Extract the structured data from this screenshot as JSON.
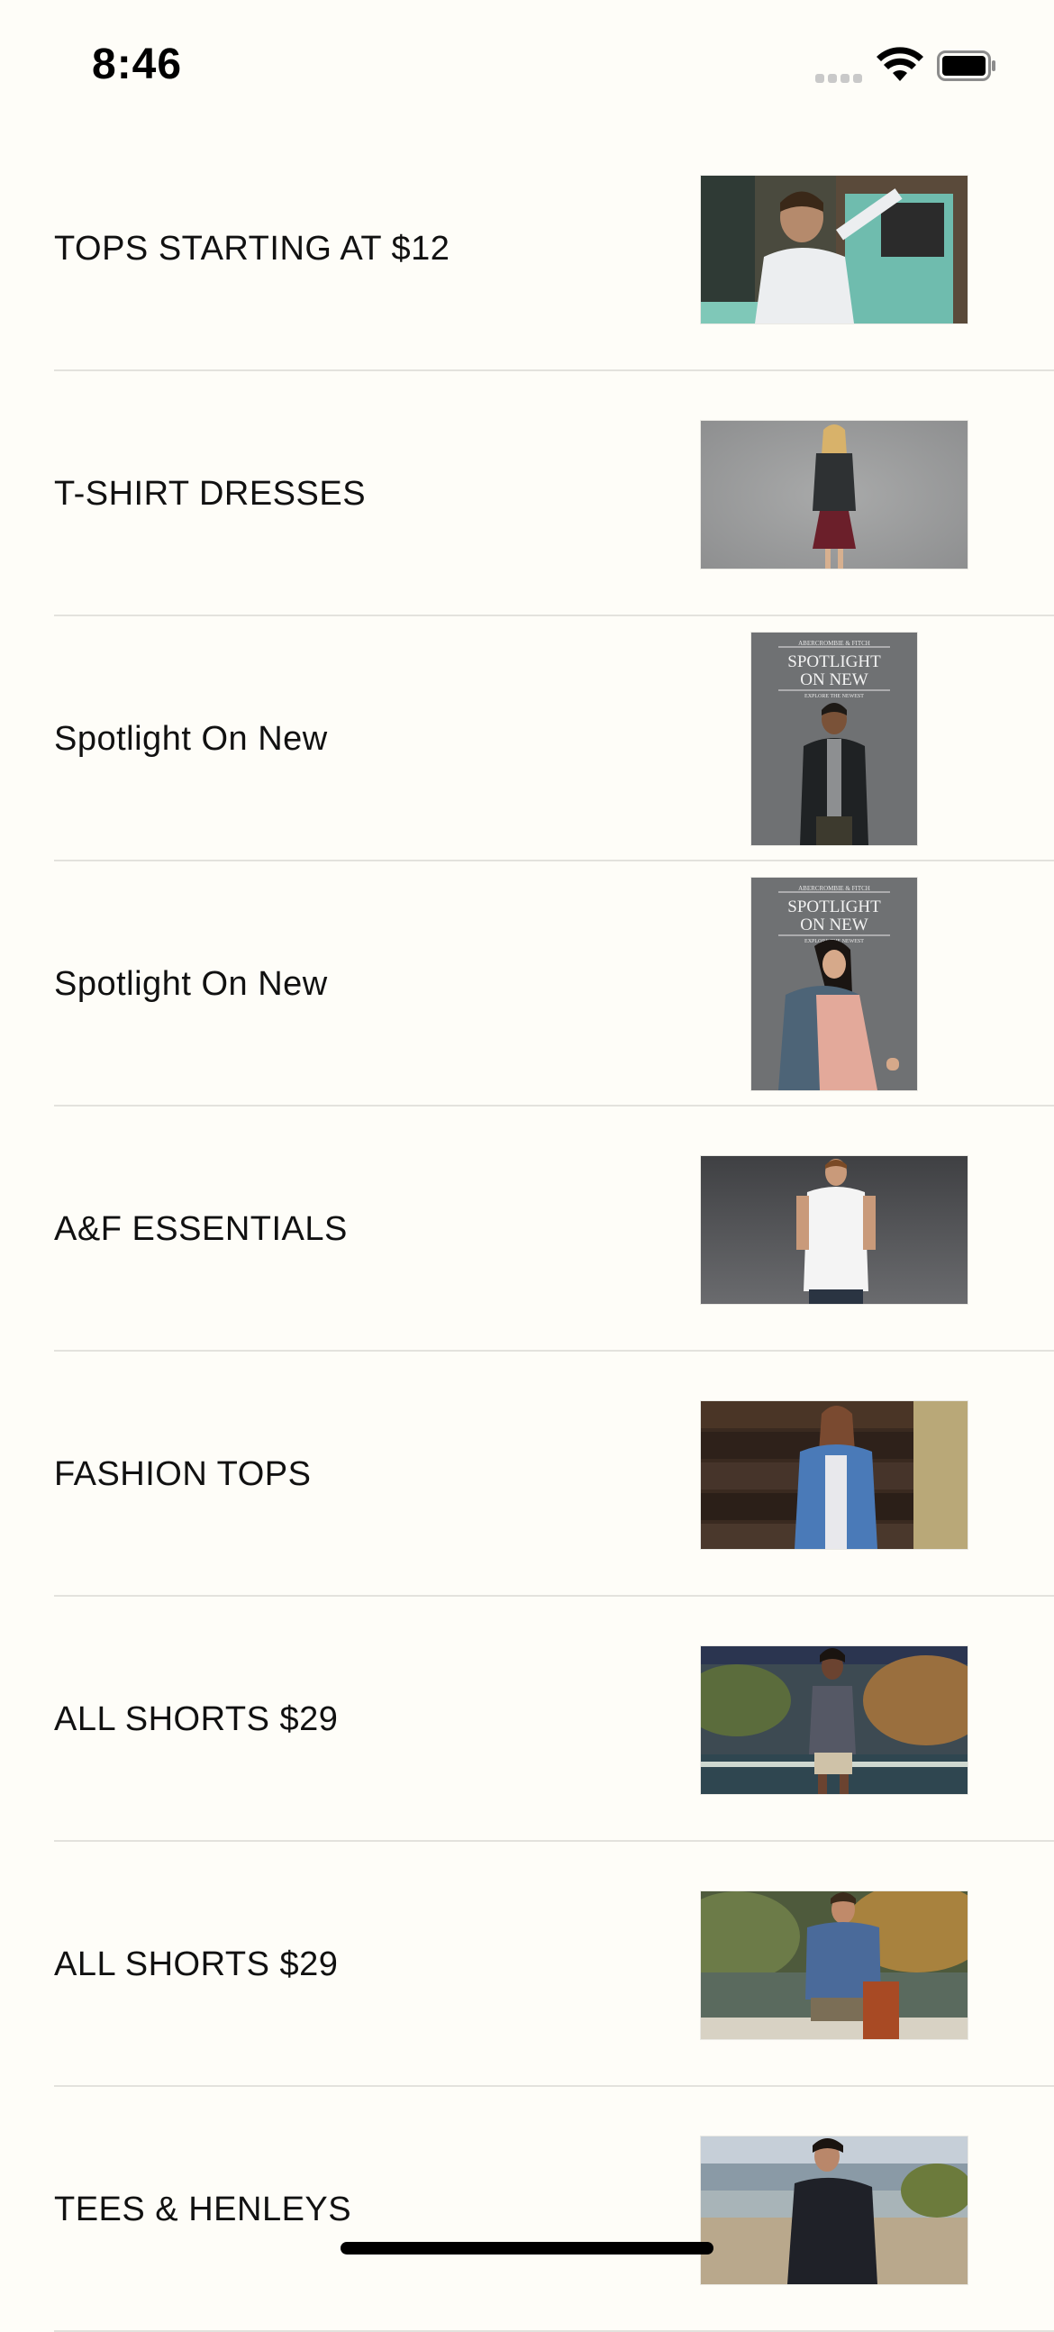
{
  "status_bar": {
    "time": "8:46",
    "icons": [
      "cellular-signal-icon",
      "wifi-icon",
      "battery-icon"
    ]
  },
  "list": {
    "items": [
      {
        "label": "TOPS STARTING AT $12",
        "image": "man-white-shirt-photo"
      },
      {
        "label": "T-SHIRT DRESSES",
        "image": "woman-leather-jacket-dress-photo"
      },
      {
        "label": "Spotlight On New",
        "image": "spotlight-on-new-man-photo",
        "overlay_title": "SPOTLIGHT ON NEW",
        "overlay_top": "ABERCROMBIE & FITCH",
        "overlay_bottom": "EXPLORE THE NEWEST"
      },
      {
        "label": "Spotlight On New",
        "image": "spotlight-on-new-woman-photo",
        "overlay_title": "SPOTLIGHT ON NEW",
        "overlay_top": "ABERCROMBIE & FITCH",
        "overlay_bottom": "EXPLORE THE NEWEST"
      },
      {
        "label": "A&F ESSENTIALS",
        "image": "man-white-henley-photo"
      },
      {
        "label": "FASHION TOPS",
        "image": "woman-denim-jacket-photo"
      },
      {
        "label": "ALL SHORTS $29",
        "image": "woman-lake-tank-photo"
      },
      {
        "label": "ALL SHORTS $29",
        "image": "man-boat-blue-tee-photo"
      },
      {
        "label": "TEES & HENLEYS",
        "image": "man-beach-henley-photo"
      }
    ]
  },
  "colors": {
    "background": "#fefdf8",
    "divider": "#e3e2dd",
    "text": "#111111"
  }
}
